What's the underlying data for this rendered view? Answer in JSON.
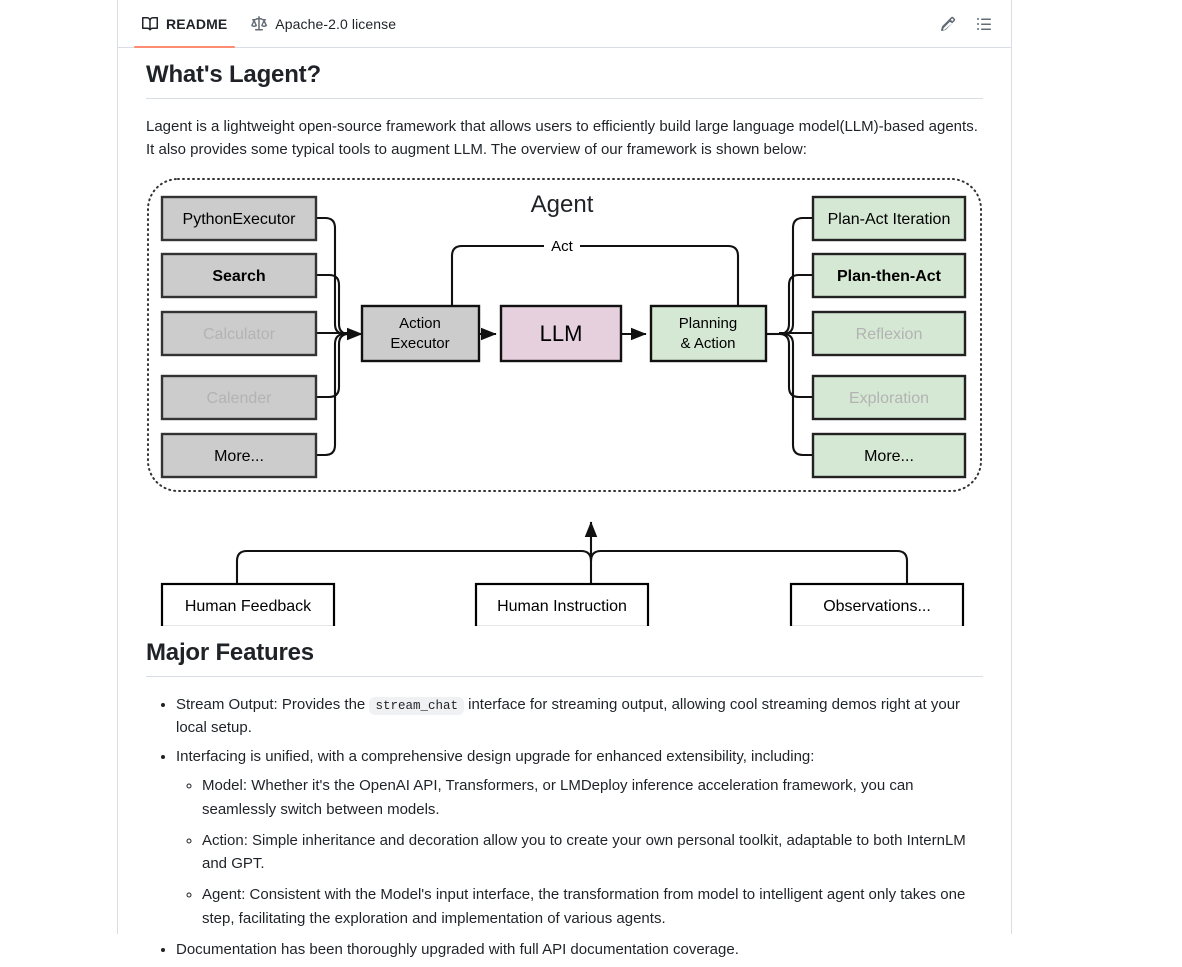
{
  "tabs": [
    {
      "label": "README",
      "icon": "book-icon",
      "active": true
    },
    {
      "label": "Apache-2.0 license",
      "icon": "law-scale-icon",
      "active": false
    }
  ],
  "toolbar": {
    "edit_label": "Edit",
    "edit_icon": "pencil-icon",
    "outline_label": "Outline",
    "outline_icon": "list-unordered-icon"
  },
  "sections": {
    "whats_lagent": {
      "heading": "What's Lagent?",
      "paragraph": "Lagent is a lightweight open-source framework that allows users to efficiently build large language model(LLM)-based agents. It also provides some typical tools to augment LLM. The overview of our framework is shown below:"
    },
    "major_features": {
      "heading": "Major Features",
      "bullets": [
        {
          "pre": "Stream Output: Provides the",
          "code": "stream_chat",
          "post": "interface for streaming output, allowing cool streaming demos right at your local setup.",
          "children": []
        },
        {
          "pre": "Interfacing is unified, with a comprehensive design upgrade for enhanced extensibility, including:",
          "code": "",
          "post": "",
          "children": [
            "Model: Whether it's the OpenAI API, Transformers, or LMDeploy inference acceleration framework, you can seamlessly switch between models.",
            "Action: Simple inheritance and decoration allow you to create your own personal toolkit, adaptable to both InternLM and GPT.",
            "Agent: Consistent with the Model's input interface, the transformation from model to intelligent agent only takes one step, facilitating the exploration and implementation of various agents."
          ]
        },
        {
          "pre": "Documentation has been thoroughly upgraded with full API documentation coverage.",
          "code": "",
          "post": "",
          "children": []
        }
      ]
    }
  },
  "diagram": {
    "title": "Agent",
    "loop_label": "Act",
    "colors": {
      "tool_fill": "#cccccc",
      "tool_stroke": "#333333",
      "llm_fill": "#e6d0de",
      "llm_stroke": "#111111",
      "strategy_fill": "#d5e8d4",
      "strategy_stroke": "#222222",
      "io_fill": "#ffffff",
      "io_stroke": "#000000",
      "muted_text": "#b3b3b3",
      "text": "#000000"
    },
    "tools": [
      {
        "label": "PythonExecutor",
        "muted": false
      },
      {
        "label": "Search",
        "muted": false
      },
      {
        "label": "Calculator",
        "muted": true
      },
      {
        "label": "Calender",
        "muted": true
      },
      {
        "label": "More...",
        "muted": false
      }
    ],
    "core": [
      {
        "label_line1": "Action",
        "label_line2": "Executor",
        "kind": "tool"
      },
      {
        "label_line1": "LLM",
        "label_line2": "",
        "kind": "llm"
      },
      {
        "label_line1": "Planning",
        "label_line2": "& Action",
        "kind": "strategy"
      }
    ],
    "strategies": [
      {
        "label": "Plan-Act Iteration",
        "muted": false
      },
      {
        "label": "Plan-then-Act",
        "muted": false
      },
      {
        "label": "Reflexion",
        "muted": true
      },
      {
        "label": "Exploration",
        "muted": true
      },
      {
        "label": "More...",
        "muted": false
      }
    ],
    "io": [
      {
        "label": "Human Feedback"
      },
      {
        "label": "Human Instruction"
      },
      {
        "label": "Observations..."
      }
    ]
  }
}
